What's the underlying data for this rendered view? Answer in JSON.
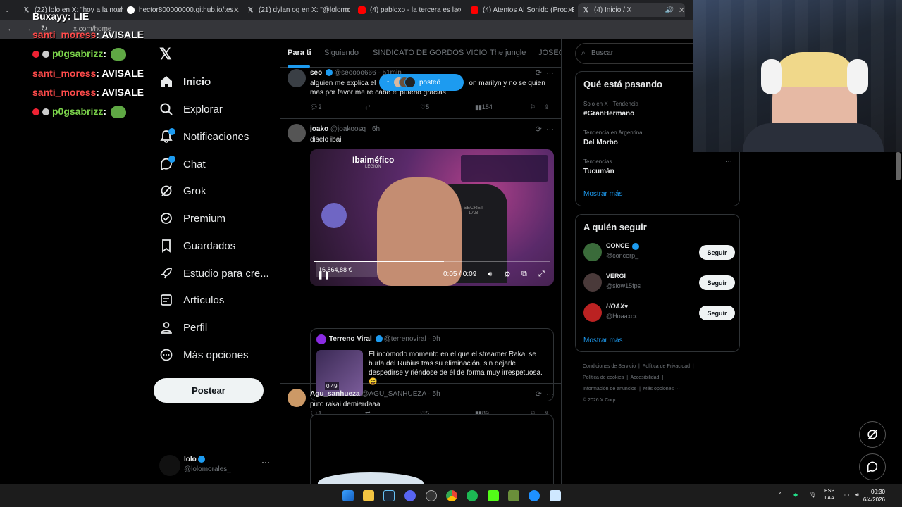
{
  "browser": {
    "tabs": [
      {
        "label": "(22) lolo en X: \"hoy a la noche...\"",
        "active": false
      },
      {
        "label": "hector800000000.github.io/tes",
        "active": false
      },
      {
        "label": "(21) dylan og en X: \"@lolomora",
        "active": false
      },
      {
        "label": "(4) pabloxo - la tercera es la ve",
        "active": false
      },
      {
        "label": "(4) Atentos Al Sonido (Prod. Ela",
        "active": false
      },
      {
        "label": "(4) Inicio / X",
        "active": true
      }
    ],
    "url": "x.com/home"
  },
  "stream_chat": {
    "messages": [
      {
        "user": "Buxayy",
        "text": "LIE"
      },
      {
        "user": "santi_moress",
        "text": "AVISALE"
      },
      {
        "user": "p0gsabrizz",
        "text": ""
      },
      {
        "user": "santi_moress",
        "text": "AVISALE"
      },
      {
        "user": "santi_moress",
        "text": "AVISALE"
      },
      {
        "user": "p0gsabrizz",
        "text": ""
      }
    ]
  },
  "sidebar": {
    "items": [
      {
        "label": "Inicio",
        "icon": "home-icon",
        "bold": true
      },
      {
        "label": "Explorar",
        "icon": "search-icon"
      },
      {
        "label": "Notificaciones",
        "icon": "bell-icon",
        "badge": true
      },
      {
        "label": "Chat",
        "icon": "chat-icon",
        "badge": true
      },
      {
        "label": "Grok",
        "icon": "grok-icon"
      },
      {
        "label": "Premium",
        "icon": "premium-icon"
      },
      {
        "label": "Guardados",
        "icon": "bookmark-icon"
      },
      {
        "label": "Estudio para cre...",
        "icon": "rocket-icon"
      },
      {
        "label": "Artículos",
        "icon": "article-icon"
      },
      {
        "label": "Perfil",
        "icon": "person-icon"
      },
      {
        "label": "Más opciones",
        "icon": "more-circle-icon"
      }
    ],
    "post_label": "Postear",
    "account": {
      "name": "lolo",
      "handle": "@lolomorales_"
    }
  },
  "feed": {
    "tabs": [
      "Para ti",
      "Siguiendo",
      "SINDICATO DE GORDOS VICIO",
      "The jungle",
      "JOSEO"
    ],
    "new_posts_pill": "posteó",
    "tweets": [
      {
        "name": "seo",
        "handle": "@seoooo666",
        "time": "51min",
        "text_a": "alguien me explica el",
        "text_b": "on marilyn  y no se quien",
        "text_c": "mas por favor me re cabe el puterio gracias",
        "replies": "2",
        "retweets": "",
        "likes": "5",
        "views": "154"
      },
      {
        "name": "joako",
        "handle": "@joakoosq",
        "time": "6h",
        "text": "diselo ibai",
        "video": {
          "time": "0:05 / 0:09",
          "overlay_title": "Ibaiméfico",
          "overlay_sub": "LEGION",
          "chair_text": "SECRET LAB",
          "money": "16.864,88 €",
          "progress": 0.55
        },
        "quote": {
          "name": "Terreno Viral",
          "handle": "@terrenoviral",
          "time": "9h",
          "text": "El incómodo momento en el que el streamer Rakai se burla del Rubius tras su eliminación, sin dejarle despedirse y riéndose de él de forma muy irrespetuosa. 😅",
          "thumb_duration": "0:49"
        },
        "replies": "1",
        "retweets": "",
        "likes": "5",
        "views": "89"
      },
      {
        "name": "Agu_sanhueza",
        "handle": "@AGU_SANHUEZA",
        "time": "5h",
        "text": "puto rakai demierdaaa"
      }
    ]
  },
  "right": {
    "search_placeholder": "Buscar",
    "trends_title": "Qué está pasando",
    "trends": [
      {
        "meta": "Solo en X · Tendencia",
        "name": "#GranHermano"
      },
      {
        "meta": "Tendencia en Argentina",
        "name": "Del Morbo"
      },
      {
        "meta": "Tendencias",
        "name": "Tucumán"
      }
    ],
    "show_more": "Mostrar más",
    "follow_title": "A quién seguir",
    "follow": [
      {
        "name": "CONCE",
        "handle": "@concerp_",
        "verified": true
      },
      {
        "name": "VERGI",
        "handle": "@slow15fps",
        "verified": false
      },
      {
        "name": "HOAX♥",
        "handle": "@Hoaaxcx",
        "verified": false
      }
    ],
    "follow_btn": "Seguir",
    "footer": {
      "links1": [
        "Condiciones de Servicio",
        "Política de Privacidad"
      ],
      "links2": [
        "Política de cookies",
        "Accesibilidad"
      ],
      "links3": [
        "Información de anuncios",
        "Más opciones ···"
      ],
      "copyright": "© 2026 X Corp."
    }
  },
  "taskbar": {
    "lang": "ESP",
    "lang2": "LAA",
    "time": "00:30",
    "date": "6/4/2026"
  },
  "colors": {
    "accent": "#1d9bf0",
    "bg": "#000000",
    "border": "#2f3336",
    "muted": "#71767b"
  }
}
